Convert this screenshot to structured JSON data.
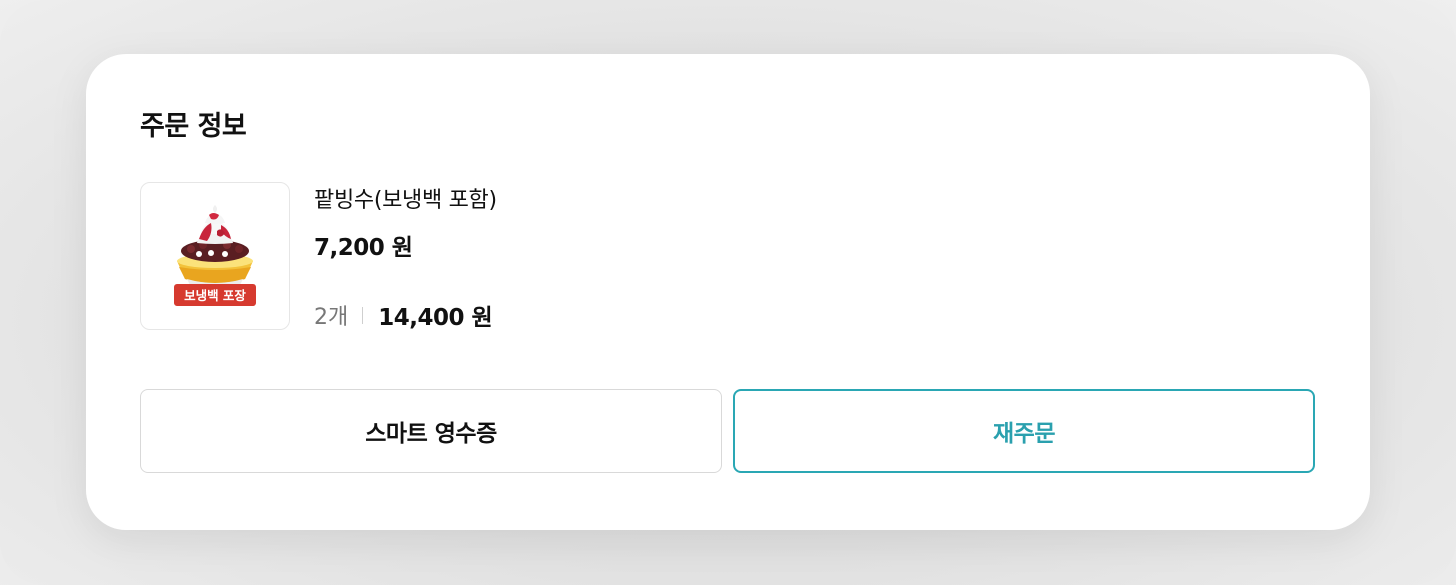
{
  "order_info": {
    "title": "주문 정보",
    "item": {
      "name": "팥빙수(보냉백 포함)",
      "unit_price": "7,200 원",
      "quantity": "2개",
      "total_price": "14,400 원",
      "image_badge": "보냉백 포장",
      "image_icon": "bingsu-icon"
    }
  },
  "actions": {
    "receipt_label": "스마트 영수증",
    "reorder_label": "재주문"
  },
  "colors": {
    "accent": "#2aa7b4",
    "badge": "#d63a2f"
  }
}
